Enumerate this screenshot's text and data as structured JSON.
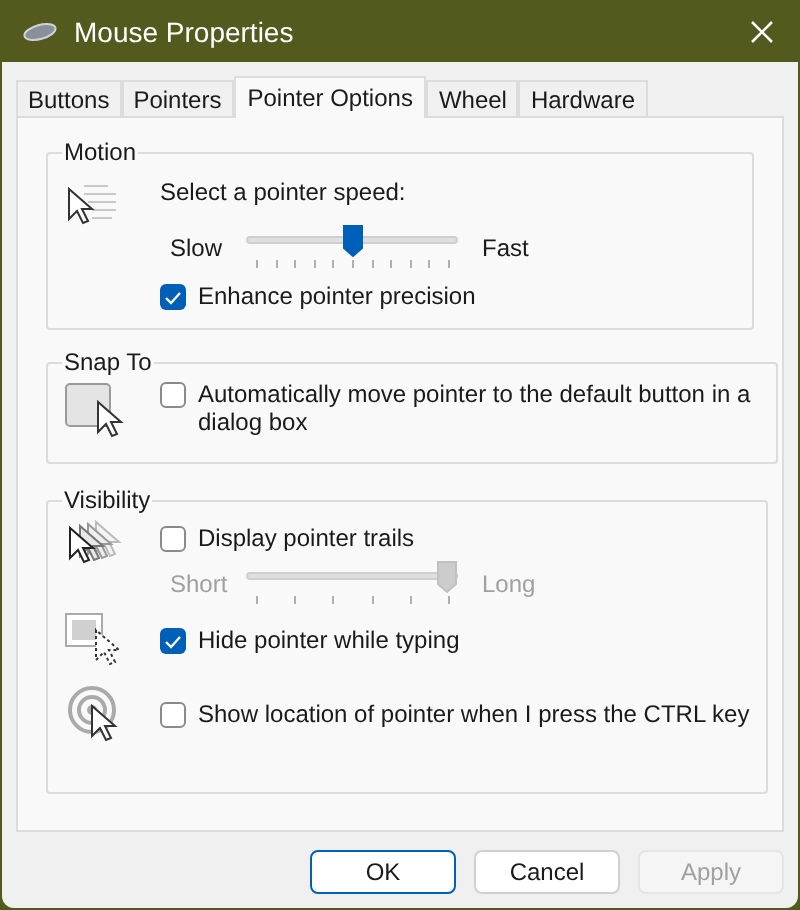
{
  "window": {
    "title": "Mouse Properties"
  },
  "tabs": [
    {
      "label": "Buttons",
      "selected": false
    },
    {
      "label": "Pointers",
      "selected": false
    },
    {
      "label": "Pointer Options",
      "selected": true
    },
    {
      "label": "Wheel",
      "selected": false
    },
    {
      "label": "Hardware",
      "selected": false
    }
  ],
  "motion": {
    "title": "Motion",
    "speed_label": "Select a pointer speed:",
    "speed_slider": {
      "min_label": "Slow",
      "max_label": "Fast",
      "level": 0.5,
      "disabled": false
    },
    "precision": {
      "label": "Enhance pointer precision",
      "checked": true
    }
  },
  "snap_to": {
    "title": "Snap To",
    "checkbox": {
      "label": "Automatically move pointer to the default button in a dialog box",
      "checked": false
    }
  },
  "visibility": {
    "title": "Visibility",
    "trails": {
      "label": "Display pointer trails",
      "checked": false
    },
    "trails_slider": {
      "min_label": "Short",
      "max_label": "Long",
      "level": 1,
      "disabled": true
    },
    "hide": {
      "label": "Hide pointer while typing",
      "checked": true
    },
    "show_location": {
      "label": "Show location of pointer when I press the CTRL key",
      "checked": false
    }
  },
  "buttons": [
    {
      "label": "OK",
      "default": true,
      "disabled": false
    },
    {
      "label": "Cancel",
      "default": false,
      "disabled": false
    },
    {
      "label": "Apply",
      "default": false,
      "disabled": true
    }
  ]
}
